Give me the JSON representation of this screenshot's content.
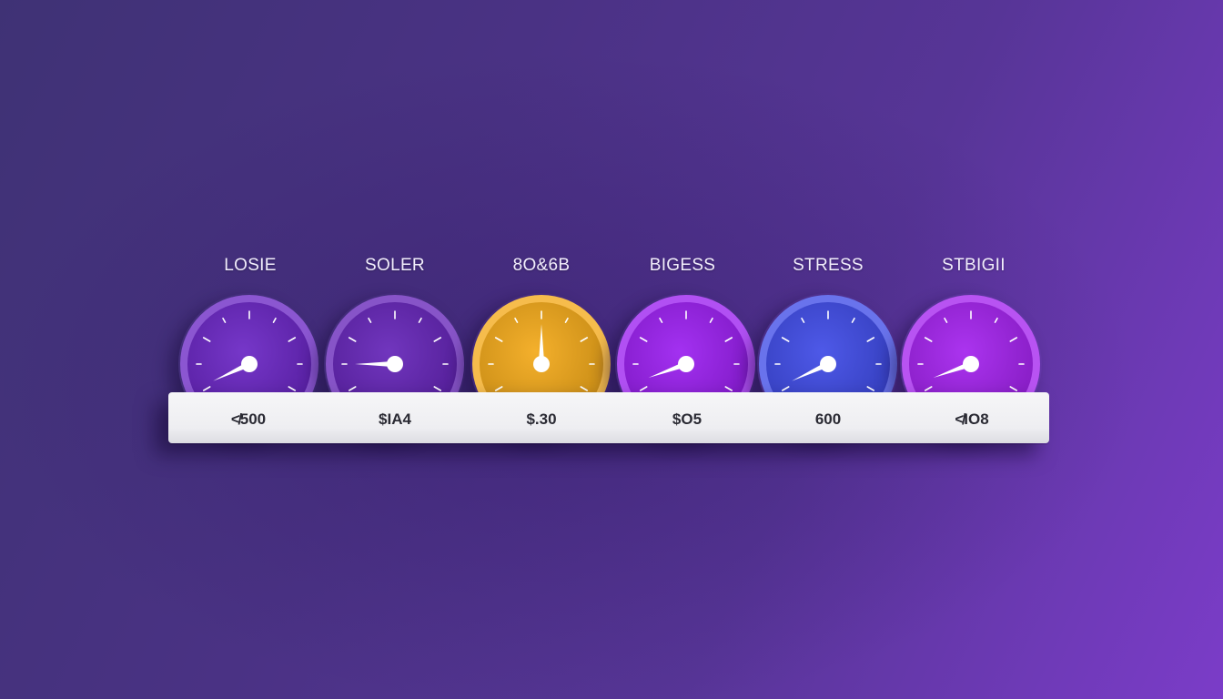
{
  "gauges": [
    {
      "label": "LOSIE",
      "value": "≮500",
      "color": "#6a26c4",
      "needle_angle": -115
    },
    {
      "label": "SOLER",
      "value": "$IA4",
      "color": "#6524b8",
      "needle_angle": -90
    },
    {
      "label": "8O&6B",
      "value": "$.30",
      "color": "#f3a91a",
      "needle_angle": 0
    },
    {
      "label": "BIGESS",
      "value": "$O5",
      "color": "#9b1ff0",
      "needle_angle": -110
    },
    {
      "label": "STRESS",
      "value": "600",
      "color": "#3f4be6",
      "needle_angle": -115
    },
    {
      "label": "STBIGII",
      "value": "≮IO8",
      "color": "#a422ee",
      "needle_angle": -110
    }
  ]
}
